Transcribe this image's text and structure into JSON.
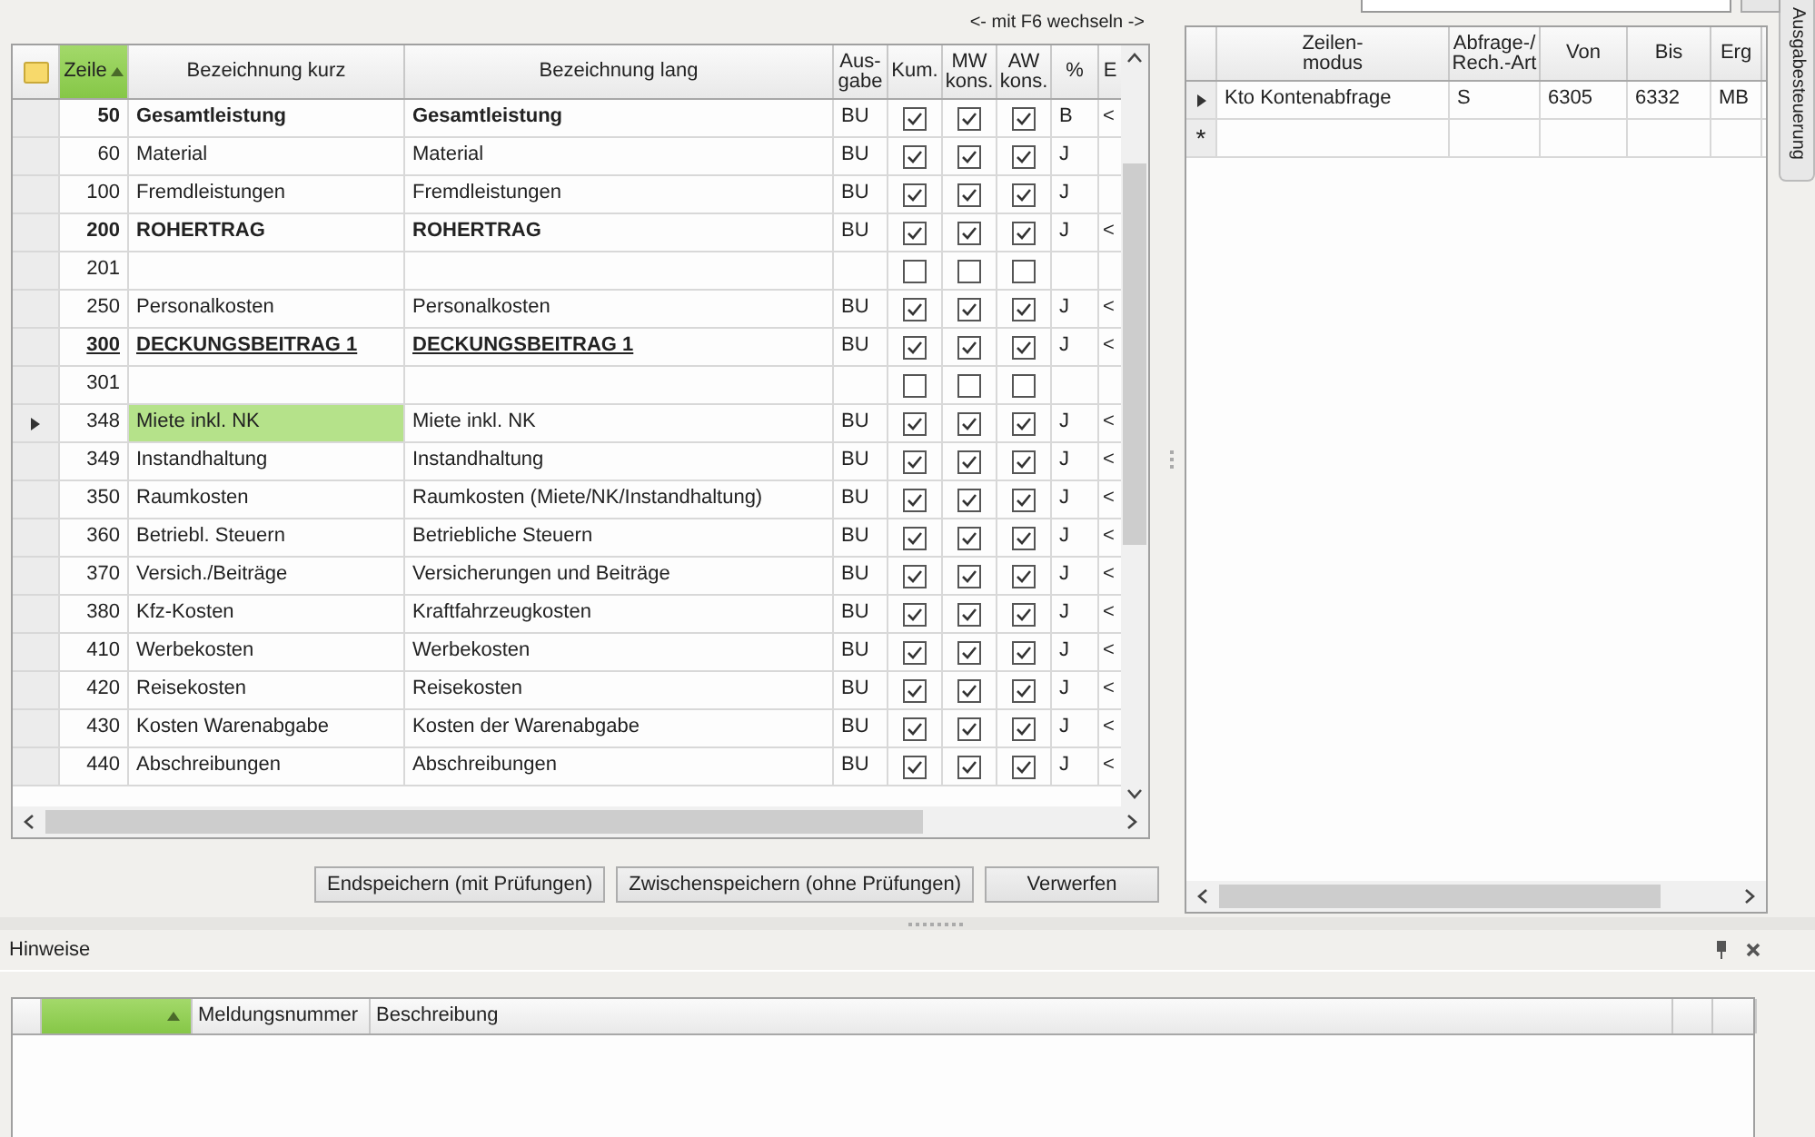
{
  "switch_hint": "<- mit F6 wechseln ->",
  "lines_table": {
    "columns": [
      {
        "kind": "note",
        "sorted": false
      },
      {
        "label": "Zeile",
        "sorted": true
      },
      {
        "label": "Bezeichnung kurz",
        "sorted": false
      },
      {
        "label": "Bezeichnung lang",
        "sorted": false
      },
      {
        "label": "Aus-\ngabe",
        "sorted": false
      },
      {
        "label": "Kum.",
        "sorted": false
      },
      {
        "label": "MW\nkons.",
        "sorted": false
      },
      {
        "label": "AW\nkons.",
        "sorted": false
      },
      {
        "label": "%",
        "sorted": false
      },
      {
        "label": "E",
        "sorted": false
      }
    ],
    "rows": [
      {
        "zeile": "50",
        "kurz": "Gesamtleistung",
        "lang": "Gesamtleistung",
        "ausgabe": "BU",
        "kum": true,
        "mw": true,
        "aw": true,
        "pct": "B",
        "column_10": "<",
        "kind": "bold",
        "selected": false
      },
      {
        "zeile": "60",
        "kurz": "Material",
        "lang": "Material",
        "ausgabe": "BU",
        "kum": true,
        "mw": true,
        "aw": true,
        "pct": "J",
        "kind": "normal",
        "selected": false
      },
      {
        "zeile": "100",
        "kurz": "Fremdleistungen",
        "lang": "Fremdleistungen",
        "ausgabe": "BU",
        "kum": true,
        "mw": true,
        "aw": true,
        "pct": "J",
        "kind": "normal",
        "selected": false
      },
      {
        "zeile": "200",
        "kurz": "ROHERTRAG",
        "lang": "ROHERTRAG",
        "ausgabe": "BU",
        "kum": true,
        "mw": true,
        "aw": true,
        "pct": "J",
        "column_10": "<",
        "kind": "bold",
        "selected": false
      },
      {
        "zeile": "201",
        "kum": false,
        "mw": false,
        "aw": false,
        "kind": "normal",
        "selected": false
      },
      {
        "zeile": "250",
        "kurz": "Personalkosten",
        "lang": "Personalkosten",
        "ausgabe": "BU",
        "kum": true,
        "mw": true,
        "aw": true,
        "pct": "J",
        "column_10": "<",
        "kind": "normal",
        "selected": false
      },
      {
        "zeile": "300",
        "kurz": "DECKUNGSBEITRAG 1",
        "lang": "DECKUNGSBEITRAG 1",
        "ausgabe": "BU",
        "kum": true,
        "mw": true,
        "aw": true,
        "pct": "J",
        "column_10": "<",
        "kind": "bold_underline",
        "selected": false
      },
      {
        "zeile": "301",
        "kum": false,
        "mw": false,
        "aw": false,
        "kind": "normal",
        "selected": false
      },
      {
        "zeile": "348",
        "kurz": "Miete inkl. NK",
        "lang": "Miete inkl. NK",
        "ausgabe": "BU",
        "kum": true,
        "mw": true,
        "aw": true,
        "pct": "J",
        "column_10": "<",
        "kind": "normal",
        "selected": true
      },
      {
        "zeile": "349",
        "kurz": "Instandhaltung",
        "lang": "Instandhaltung",
        "ausgabe": "BU",
        "kum": true,
        "mw": true,
        "aw": true,
        "pct": "J",
        "column_10": "<",
        "kind": "normal",
        "selected": false
      },
      {
        "zeile": "350",
        "kurz": "Raumkosten",
        "lang": "Raumkosten (Miete/NK/Instandhaltung)",
        "ausgabe": "BU",
        "kum": true,
        "mw": true,
        "aw": true,
        "pct": "J",
        "column_10": "<",
        "kind": "normal",
        "selected": false
      },
      {
        "zeile": "360",
        "kurz": "Betriebl. Steuern",
        "lang": "Betriebliche Steuern",
        "ausgabe": "BU",
        "kum": true,
        "mw": true,
        "aw": true,
        "pct": "J",
        "column_10": "<",
        "kind": "normal",
        "selected": false
      },
      {
        "zeile": "370",
        "kurz": "Versich./Beiträge",
        "lang": "Versicherungen und Beiträge",
        "ausgabe": "BU",
        "kum": true,
        "mw": true,
        "aw": true,
        "pct": "J",
        "column_10": "<",
        "kind": "normal",
        "selected": false
      },
      {
        "zeile": "380",
        "kurz": "Kfz-Kosten",
        "lang": "Kraftfahrzeugkosten",
        "ausgabe": "BU",
        "kum": true,
        "mw": true,
        "aw": true,
        "pct": "J",
        "column_10": "<",
        "kind": "normal",
        "selected": false
      },
      {
        "zeile": "410",
        "kurz": "Werbekosten",
        "lang": "Werbekosten",
        "ausgabe": "BU",
        "kum": true,
        "mw": true,
        "aw": true,
        "pct": "J",
        "column_10": "<",
        "kind": "normal",
        "selected": false
      },
      {
        "zeile": "420",
        "kurz": "Reisekosten",
        "lang": "Reisekosten",
        "ausgabe": "BU",
        "kum": true,
        "mw": true,
        "aw": true,
        "pct": "J",
        "column_10": "<",
        "kind": "normal",
        "selected": false
      },
      {
        "zeile": "430",
        "kurz": "Kosten Warenabgabe",
        "lang": "Kosten der Warenabgabe",
        "ausgabe": "BU",
        "kum": true,
        "mw": true,
        "aw": true,
        "pct": "J",
        "column_10": "<",
        "kind": "normal",
        "selected": false
      },
      {
        "zeile": "440",
        "kurz": "Abschreibungen",
        "lang": "Abschreibungen",
        "ausgabe": "BU",
        "kum": true,
        "mw": true,
        "aw": true,
        "pct": "J",
        "column_10": "<",
        "kind": "normal",
        "selected": false
      }
    ]
  },
  "buttons": [
    "Endspeichern (mit Prüfungen)",
    "Zwischenspeichern (ohne Prüfungen)",
    "Verwerfen"
  ],
  "query_table": {
    "columns": [
      "Zeilen-\nmodus",
      "Abfrage-/\nRech.-Art",
      "Von",
      "Bis",
      "Erg"
    ],
    "rows": [
      {
        "cells": [
          "Kto Kontenabfrage",
          "S",
          "6305",
          "6332",
          "MB"
        ],
        "selected": true
      }
    ],
    "new_row_marker": "*"
  },
  "side_tab": "Ausgabesteuerung",
  "hints_panel": {
    "title": "Hinweise",
    "columns": [
      {
        "sorted": true
      },
      {
        "label": "Meldungsnummer",
        "sorted": false
      },
      {
        "label": "Beschreibung",
        "sorted": false
      },
      {
        "sorted": false
      },
      {
        "sorted": false
      }
    ]
  }
}
